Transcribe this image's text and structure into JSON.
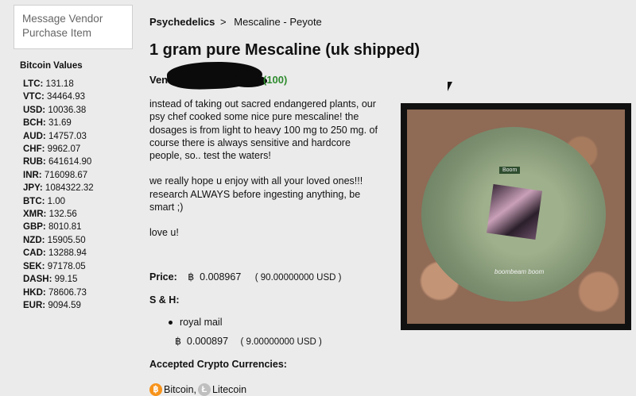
{
  "sidebar": {
    "menu": [
      "Message Vendor",
      "Purchase Item"
    ],
    "rates_title": "Bitcoin Values",
    "rates": [
      {
        "code": "LTC:",
        "value": "131.18"
      },
      {
        "code": "VTC:",
        "value": "34464.93"
      },
      {
        "code": "USD:",
        "value": "10036.38"
      },
      {
        "code": "BCH:",
        "value": "31.69"
      },
      {
        "code": "AUD:",
        "value": "14757.03"
      },
      {
        "code": "CHF:",
        "value": "9962.07"
      },
      {
        "code": "RUB:",
        "value": "641614.90"
      },
      {
        "code": "INR:",
        "value": "716098.67"
      },
      {
        "code": "JPY:",
        "value": "1084322.32"
      },
      {
        "code": "BTC:",
        "value": "1.00"
      },
      {
        "code": "XMR:",
        "value": "132.56"
      },
      {
        "code": "GBP:",
        "value": "8010.81"
      },
      {
        "code": "NZD:",
        "value": "15905.50"
      },
      {
        "code": "CAD:",
        "value": "13288.94"
      },
      {
        "code": "SEK:",
        "value": "97178.05"
      },
      {
        "code": "DASH:",
        "value": "99.15"
      },
      {
        "code": "HKD:",
        "value": "78606.73"
      },
      {
        "code": "EUR:",
        "value": "9094.59"
      }
    ]
  },
  "breadcrumb": {
    "category": "Psychedelics",
    "separator": ">",
    "subcategory": "Mescaline - Peyote"
  },
  "listing": {
    "title": "1 gram pure Mescaline (uk shipped)",
    "vendor_label": "Vendor",
    "vendor_score": "(100)",
    "description": [
      "instead of taking out sacred endangered plants, our psy chef cooked some nice pure mescaline! the dosages is from light to heavy 100 mg to 250 mg. of course there is always sensitive and hardcore people, so.. test the waters!",
      "we really hope u enjoy with all your loved ones!!! research ALWAYS before ingesting anything, be smart ;)",
      "love u!"
    ],
    "image": {
      "tag_text": "Boom",
      "watermark": "boombeam boom"
    }
  },
  "price": {
    "label": "Price:",
    "symbol": "฿",
    "btc": "0.008967",
    "usd": "( 90.00000000 USD )"
  },
  "shipping": {
    "label": "S & H:",
    "method": "royal mail",
    "symbol": "฿",
    "btc": "0.000897",
    "usd": "( 9.00000000 USD )"
  },
  "accepted": {
    "label": "Accepted Crypto Currencies:",
    "coins": [
      {
        "icon": "bitcoin-icon",
        "glyph": "฿",
        "name": "Bitcoin",
        "suffix": ","
      },
      {
        "icon": "litecoin-icon",
        "glyph": "Ł",
        "name": "Litecoin",
        "suffix": ""
      }
    ]
  },
  "colors": {
    "background": "#ebebeb",
    "vendor_score": "#2e8b2e",
    "bitcoin": "#f7931a",
    "litecoin": "#bfbfbf"
  }
}
